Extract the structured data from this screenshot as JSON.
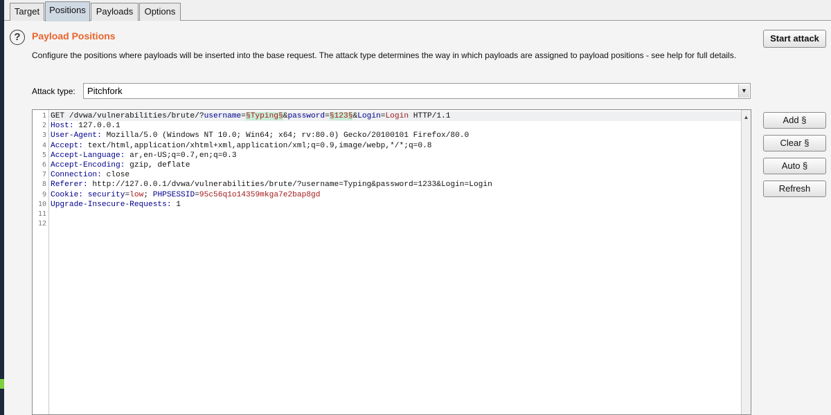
{
  "tabs": [
    {
      "label": "Target",
      "active": false
    },
    {
      "label": "Positions",
      "active": true
    },
    {
      "label": "Payloads",
      "active": false
    },
    {
      "label": "Options",
      "active": false
    }
  ],
  "section": {
    "help_icon": "?",
    "title": "Payload Positions",
    "description": "Configure the positions where payloads will be inserted into the base request. The attack type determines the way in which payloads are assigned to payload positions - see help for full details."
  },
  "start_attack_label": "Start attack",
  "attack_type": {
    "label": "Attack type:",
    "value": "Pitchfork"
  },
  "side_buttons": {
    "add": "Add §",
    "clear": "Clear §",
    "auto": "Auto §",
    "refresh": "Refresh"
  },
  "editor": {
    "line_numbers": [
      "1",
      "2",
      "3",
      "4",
      "5",
      "6",
      "7",
      "8",
      "9",
      "10",
      "11",
      "12"
    ],
    "request_line": {
      "method_path": "GET /dvwa/vulnerabilities/brute/?",
      "p1_name": "username",
      "eq": "=",
      "p1_value": "§Typing§",
      "amp1": "&",
      "p2_name": "password",
      "p2_value": "§123§",
      "amp2": "&",
      "p3_name": "Login",
      "p3_value": "Login",
      "protocol": " HTTP/1.1"
    },
    "headers": [
      {
        "key": "Host:",
        "value": " 127.0.0.1"
      },
      {
        "key": "User-Agent:",
        "value": " Mozilla/5.0 (Windows NT 10.0; Win64; x64; rv:80.0) Gecko/20100101 Firefox/80.0"
      },
      {
        "key": "Accept:",
        "value": " text/html,application/xhtml+xml,application/xml;q=0.9,image/webp,*/*;q=0.8"
      },
      {
        "key": "Accept-Language:",
        "value": " ar,en-US;q=0.7,en;q=0.3"
      },
      {
        "key": "Accept-Encoding:",
        "value": " gzip, deflate"
      },
      {
        "key": "Connection:",
        "value": " close"
      },
      {
        "key": "Referer:",
        "value": " http://127.0.0.1/dvwa/vulnerabilities/brute/?username=Typing&password=1233&Login=Login"
      }
    ],
    "cookie": {
      "key": "Cookie:",
      "c1_name": " security",
      "c1_eq": "=",
      "c1_value": "low",
      "sep": "; ",
      "c2_name": "PHPSESSID",
      "c2_eq": "=",
      "c2_value": "95c56q1o14359mkga7e2bap8gd"
    },
    "last_header": {
      "key": "Upgrade-Insecure-Requests:",
      "value": " 1"
    }
  }
}
